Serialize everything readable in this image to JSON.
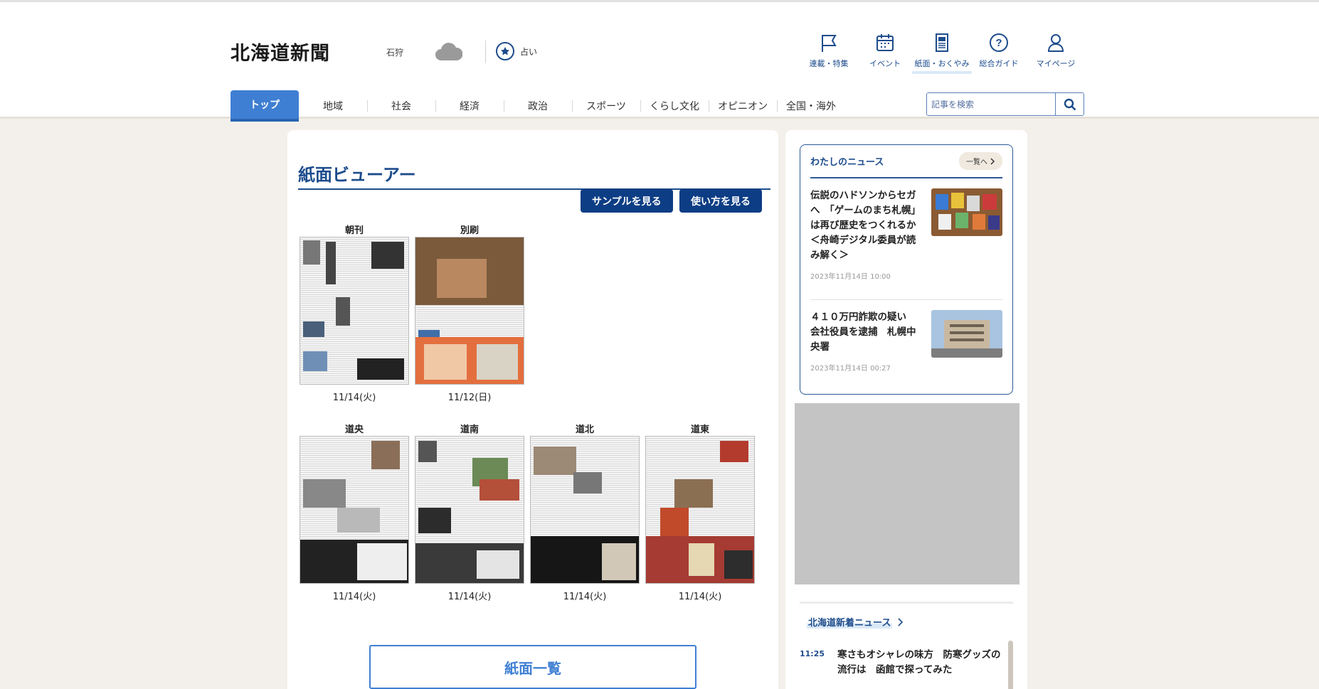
{
  "header": {
    "logo": "北海道新聞",
    "area": "石狩",
    "weather_icon": "cloud-icon",
    "fortune_label": "占い",
    "utilities": [
      {
        "label": "連載・特集",
        "icon": "flag-icon"
      },
      {
        "label": "イベント",
        "icon": "calendar-icon"
      },
      {
        "label": "紙面・おくやみ",
        "icon": "newspaper-icon"
      },
      {
        "label": "総合ガイド",
        "icon": "help-icon"
      },
      {
        "label": "マイページ",
        "icon": "user-icon"
      }
    ]
  },
  "nav": {
    "tabs": [
      "トップ",
      "地域",
      "社会",
      "経済",
      "政治",
      "スポーツ",
      "くらし文化",
      "オピニオン",
      "全国・海外"
    ]
  },
  "search": {
    "placeholder": "記事を検索"
  },
  "viewer": {
    "title": "紙面ビューアー",
    "sample_button": "サンプルを見る",
    "howto_button": "使い方を見る",
    "row1": [
      {
        "label": "朝刊",
        "date": "11/14(火)"
      },
      {
        "label": "別刷",
        "date": "11/12(日)"
      }
    ],
    "row2": [
      {
        "label": "道央",
        "date": "11/14(火)"
      },
      {
        "label": "道南",
        "date": "11/14(火)"
      },
      {
        "label": "道北",
        "date": "11/14(火)"
      },
      {
        "label": "道東",
        "date": "11/14(火)"
      }
    ],
    "list_button": "紙面一覧"
  },
  "sidebar": {
    "mynews": {
      "title": "わたしのニュース",
      "more": "一覧へ",
      "items": [
        {
          "title": "伝説のハドソンからセガへ　「ゲームのまち札幌」は再び歴史をつくれるか＜舟崎デジタル委員が読み解く＞",
          "time": "2023年11月14日 10:00"
        },
        {
          "title": "４１０万円詐欺の疑い　会社役員を逮捕　札幌中央署",
          "time": "2023年11月14日 00:27"
        }
      ]
    },
    "hokkaido": {
      "title": "北海道新着ニュース",
      "items": [
        {
          "time": "11:25",
          "title": "寒さもオシャレの味方　防寒グッズの流行は　函館で探ってみた"
        }
      ]
    }
  },
  "colors": {
    "brand_navy": "#0d3d84",
    "accent_blue": "#3f7fd3",
    "background": "#f3f0eb"
  }
}
